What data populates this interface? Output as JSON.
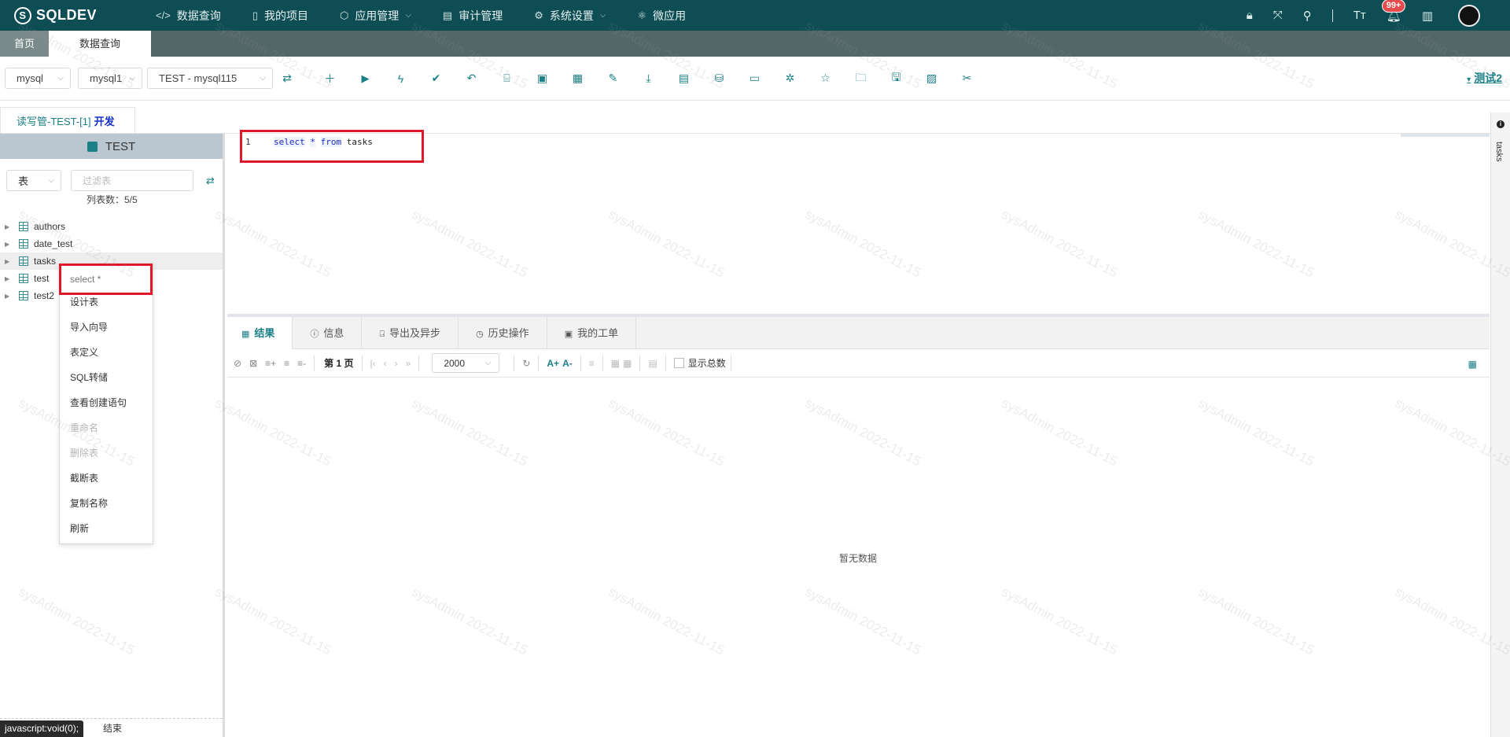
{
  "app": {
    "logo": "SQLDEV"
  },
  "nav": [
    {
      "label": "数据查询",
      "icon": "code-icon",
      "glyph": "</>",
      "dropdown": false
    },
    {
      "label": "我的项目",
      "icon": "book-icon",
      "glyph": "▯",
      "dropdown": false
    },
    {
      "label": "应用管理",
      "icon": "cube-icon",
      "glyph": "⬡",
      "dropdown": true
    },
    {
      "label": "审计管理",
      "icon": "document-icon",
      "glyph": "▤",
      "dropdown": false
    },
    {
      "label": "系统设置",
      "icon": "gear-icon",
      "glyph": "⚙",
      "dropdown": true
    },
    {
      "label": "微应用",
      "icon": "atom-icon",
      "glyph": "⚛",
      "dropdown": false
    }
  ],
  "notifications": {
    "badge": "99+"
  },
  "page_tabs": {
    "home": "首页",
    "active": "数据查询"
  },
  "toolbar": {
    "db_type": "mysql",
    "db_instance": "mysql1",
    "connection": "TEST - mysql115",
    "right_link": "测试2"
  },
  "conn_tab": {
    "label": "读写管-TEST-[1]",
    "env": "开发"
  },
  "left": {
    "schema": "TEST",
    "object_type": "表",
    "filter_placeholder": "过滤表",
    "count": "列表数：5/5",
    "tables": [
      "authors",
      "date_test",
      "tasks",
      "test",
      "test2"
    ],
    "selected": "tasks",
    "bottom_label": "结束"
  },
  "context_menu": [
    "select *",
    "设计表",
    "导入向导",
    "表定义",
    "SQL转储",
    "查看创建语句",
    "重命名",
    "删除表",
    "截断表",
    "复制名称",
    "刷新"
  ],
  "context_menu_disabled": [
    "重命名",
    "删除表"
  ],
  "editor": {
    "line": "1",
    "tokens": [
      {
        "t": "select",
        "kw": true
      },
      {
        "t": " ",
        "kw": false
      },
      {
        "t": "*",
        "kw": true
      },
      {
        "t": " ",
        "kw": false
      },
      {
        "t": "from",
        "kw": true
      },
      {
        "t": " tasks",
        "kw": false
      }
    ]
  },
  "results": {
    "tabs": [
      "结果",
      "信息",
      "导出及异步",
      "历史操作",
      "我的工单"
    ],
    "page": "第 1 页",
    "page_size": "2000",
    "show_total": "显示总数",
    "font_plus": "A+",
    "font_minus": "A-",
    "empty": "暂无数据"
  },
  "side": {
    "label": "tasks"
  },
  "status_tip": "javascript:void(0);",
  "watermark": "sysAdmin 2022-11-15"
}
